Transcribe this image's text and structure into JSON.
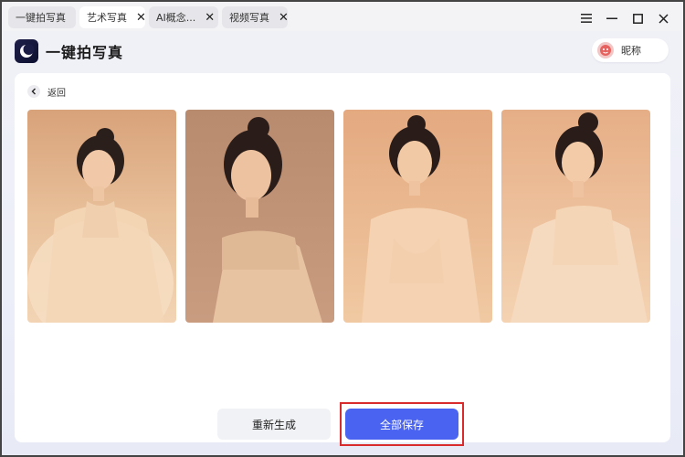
{
  "tabs": [
    {
      "label": "一键拍写真",
      "active": false,
      "closable": false
    },
    {
      "label": "艺术写真",
      "active": true,
      "closable": true
    },
    {
      "label": "AI概念...",
      "active": false,
      "closable": true
    },
    {
      "label": "视频写真",
      "active": false,
      "closable": true
    }
  ],
  "window_controls": {
    "menu_icon": "hamburger-icon",
    "minimize_icon": "minimize-icon",
    "maximize_icon": "maximize-icon",
    "close_icon": "close-icon"
  },
  "header": {
    "app_title": "一键拍写真",
    "logo_icon": "moon-app-logo-icon"
  },
  "user": {
    "name": "昵称",
    "avatar_icon": "avatar-icon"
  },
  "nav": {
    "back_label": "返回",
    "back_icon": "chevron-left-icon"
  },
  "gallery": {
    "photos": [
      {
        "name": "photo-1"
      },
      {
        "name": "photo-2"
      },
      {
        "name": "photo-3"
      },
      {
        "name": "photo-4"
      }
    ]
  },
  "actions": {
    "regenerate_label": "重新生成",
    "save_all_label": "全部保存"
  },
  "colors": {
    "accent": "#4a63f0",
    "highlight_outline": "#d92b2b",
    "background": "#eceef8"
  }
}
